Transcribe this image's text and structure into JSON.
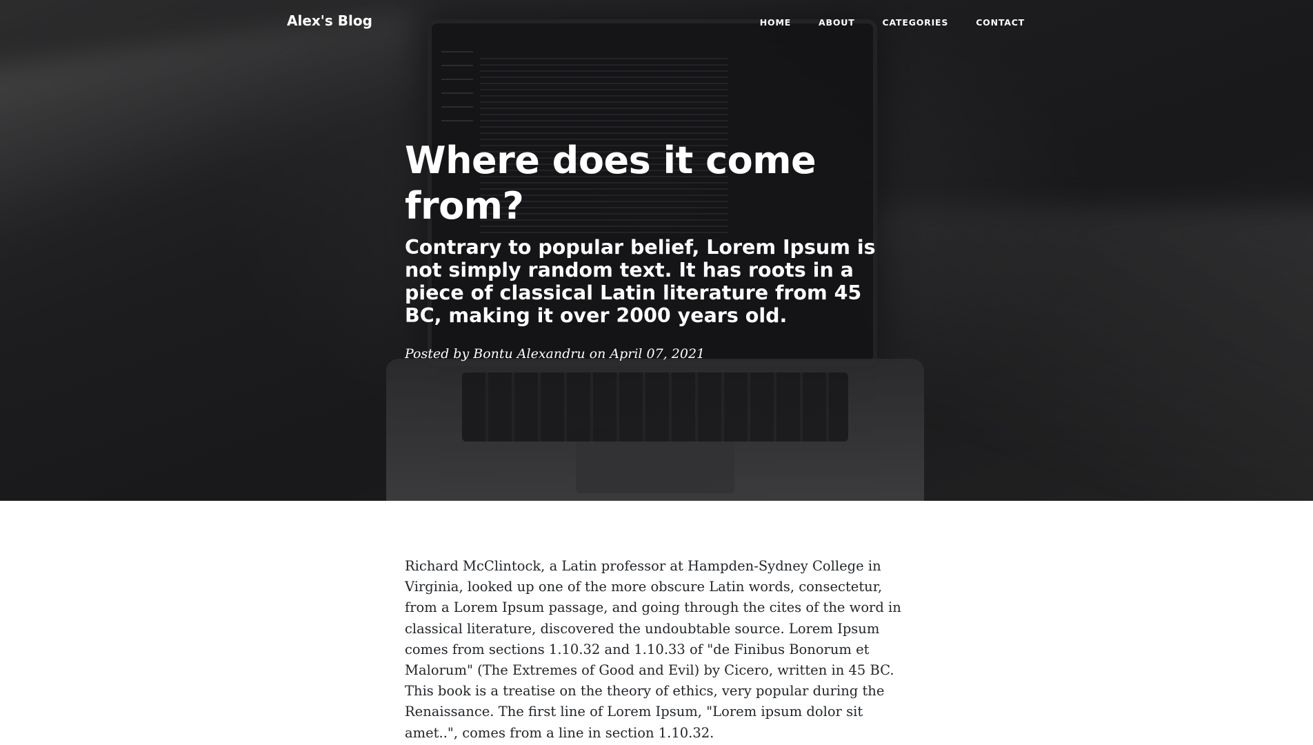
{
  "navbar": {
    "brand": "Alex's Blog",
    "links": [
      "HOME",
      "ABOUT",
      "CATEGORIES",
      "CONTACT"
    ]
  },
  "post": {
    "title": "Where does it come from?",
    "subtitle": "Contrary to popular belief, Lorem Ipsum is not simply random text. It has roots in a piece of classical Latin literature from 45 BC, making it over 2000 years old.",
    "meta_prefix": "Posted by",
    "author": "Bontu Alexandru",
    "meta_on": "on",
    "date": "April 07, 2021",
    "body": "Richard McClintock, a Latin professor at Hampden-Sydney College in Virginia, looked up one of the more obscure Latin words, consectetur, from a Lorem Ipsum passage, and going through the cites of the word in classical literature, discovered the undoubtable source. Lorem Ipsum comes from sections 1.10.32 and 1.10.33 of \"de Finibus Bonorum et Malorum\" (The Extremes of Good and Evil) by Cicero, written in 45 BC. This book is a treatise on the theory of ethics, very popular during the Renaissance. The first line of Lorem Ipsum, \"Lorem ipsum dolor sit amet..\", comes from a line in section 1.10.32."
  },
  "hero_image": {
    "subject": "laptop-with-code-editor"
  },
  "colors": {
    "hero_text": "#ffffff",
    "body_text": "#212529",
    "page_background": "#ffffff"
  }
}
